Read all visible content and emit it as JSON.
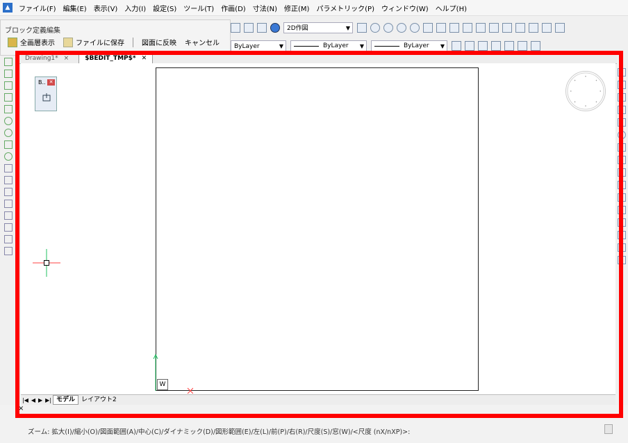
{
  "menubar": {
    "items": [
      "ファイル(F)",
      "編集(E)",
      "表示(V)",
      "入力(I)",
      "設定(S)",
      "ツール(T)",
      "作画(D)",
      "寸法(N)",
      "修正(M)",
      "パラメトリック(P)",
      "ウィンドウ(W)",
      "ヘルプ(H)"
    ]
  },
  "block_panel": {
    "title": "ブロック定義編集",
    "buttons": [
      "全画層表示",
      "ファイルに保存",
      "図面に反映",
      "キャンセル"
    ]
  },
  "toolbar": {
    "workspace": "2D作図",
    "layer_color": "ByLayer",
    "layer_linetype": "ByLayer",
    "layer_lineweight": "ByLayer"
  },
  "doc_tabs": [
    {
      "label": "Drawing1*",
      "close": "×"
    },
    {
      "label": "$BEDIT_TMP$*",
      "close": "✕"
    }
  ],
  "block_palette": {
    "label": "B..",
    "close": "✕"
  },
  "ucs": {
    "label": "W"
  },
  "layout_tabs": {
    "nav": [
      "|◀",
      "◀",
      "▶",
      "▶|"
    ],
    "tabs": [
      "モデル",
      "レイアウト2"
    ]
  },
  "command": {
    "close": "×",
    "prompt": "ズーム: 拡大(I)/縮小(O)/図面範囲(A)/中心(C)/ダイナミック(D)/図形範囲(E)/左(L)/前(P)/右(R)/尺度(S)/窓(W)/<尺度 (nX/nXP)>:"
  },
  "colors": {
    "highlight": "#ff0000",
    "crosshair_h": "#ff4040",
    "crosshair_v": "#20c060"
  }
}
